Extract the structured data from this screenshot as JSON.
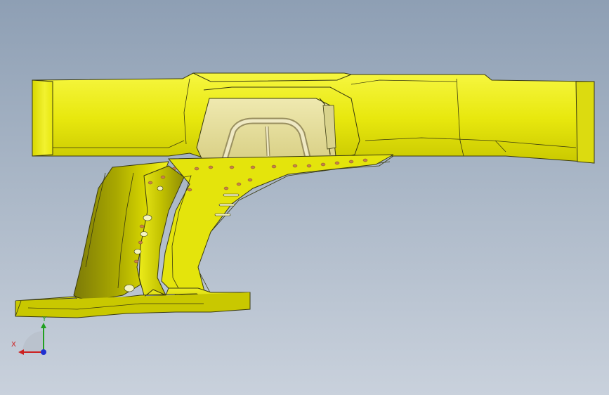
{
  "app": {
    "view_type": "3D model viewport"
  },
  "viewport": {
    "background_top": "#8e9fb4",
    "background_bottom": "#c9d1dc",
    "model_color": "#e8e80e",
    "model_shade": "#a9a800",
    "edge_color": "#3a3a10",
    "inner_panel_color": "#e6df9c",
    "hole_color": "#c8824a"
  },
  "triad": {
    "x_label": "X",
    "y_label": "Y",
    "x_color": "#cc2020",
    "y_color": "#20a020",
    "z_color": "#2030d0"
  }
}
